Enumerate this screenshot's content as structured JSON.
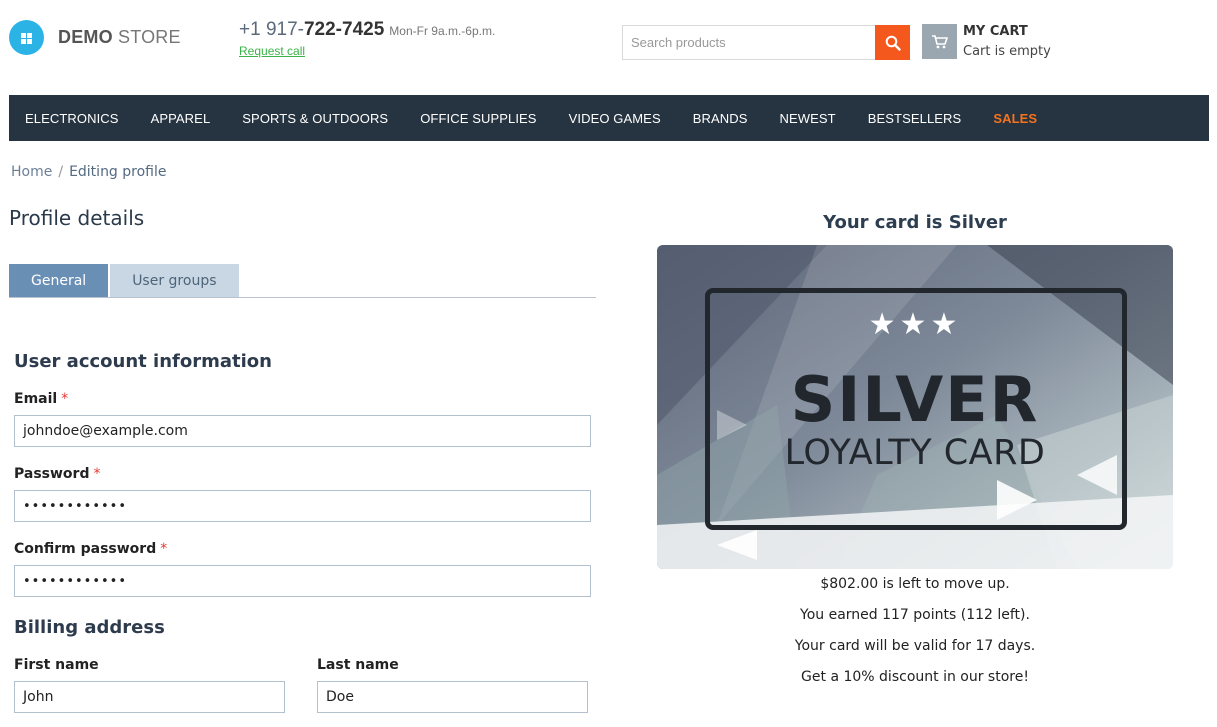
{
  "header": {
    "logo_bold": "DEMO",
    "logo_light": "STORE",
    "phone_prefix": "+1 917-",
    "phone_main": "722-7425",
    "phone_hours": "Mon-Fr 9a.m.-6p.m.",
    "request_call": "Request call",
    "search_placeholder": "Search products",
    "cart_title": "MY CART",
    "cart_status": "Cart is empty"
  },
  "nav": {
    "items": [
      "ELECTRONICS",
      "APPAREL",
      "SPORTS & OUTDOORS",
      "OFFICE SUPPLIES",
      "VIDEO GAMES",
      "BRANDS",
      "NEWEST",
      "BESTSELLERS"
    ],
    "sales": "SALES",
    "sales_color": "#f5731d"
  },
  "breadcrumb": {
    "home": "Home",
    "separator": "/",
    "current": "Editing profile"
  },
  "profile": {
    "title": "Profile details",
    "tabs": [
      "General",
      "User groups"
    ],
    "account_section": "User account information",
    "email_label": "Email",
    "email_value": "johndoe@example.com",
    "password_label": "Password",
    "password_value": "••••••••••••",
    "confirm_label": "Confirm password",
    "confirm_value": "••••••••••••",
    "required_mark": "*",
    "billing_section": "Billing address",
    "first_name_label": "First name",
    "first_name_value": "John",
    "last_name_label": "Last name",
    "last_name_value": "Doe"
  },
  "loyalty": {
    "heading": "Your card is Silver",
    "stars": "★★★",
    "tier": "SILVER",
    "subtitle": "LOYALTY CARD",
    "info": [
      "$802.00 is left to move up.",
      "You earned 117 points (112 left).",
      "Your card will be valid for 17 days.",
      "Get a 10% discount in our store!"
    ]
  },
  "colors": {
    "accent_orange": "#f5581d",
    "nav_bg": "#263340",
    "tab_active": "#6a8fb5",
    "tab_inactive": "#c9d7e4",
    "logo_blue": "#2bb3e6"
  }
}
